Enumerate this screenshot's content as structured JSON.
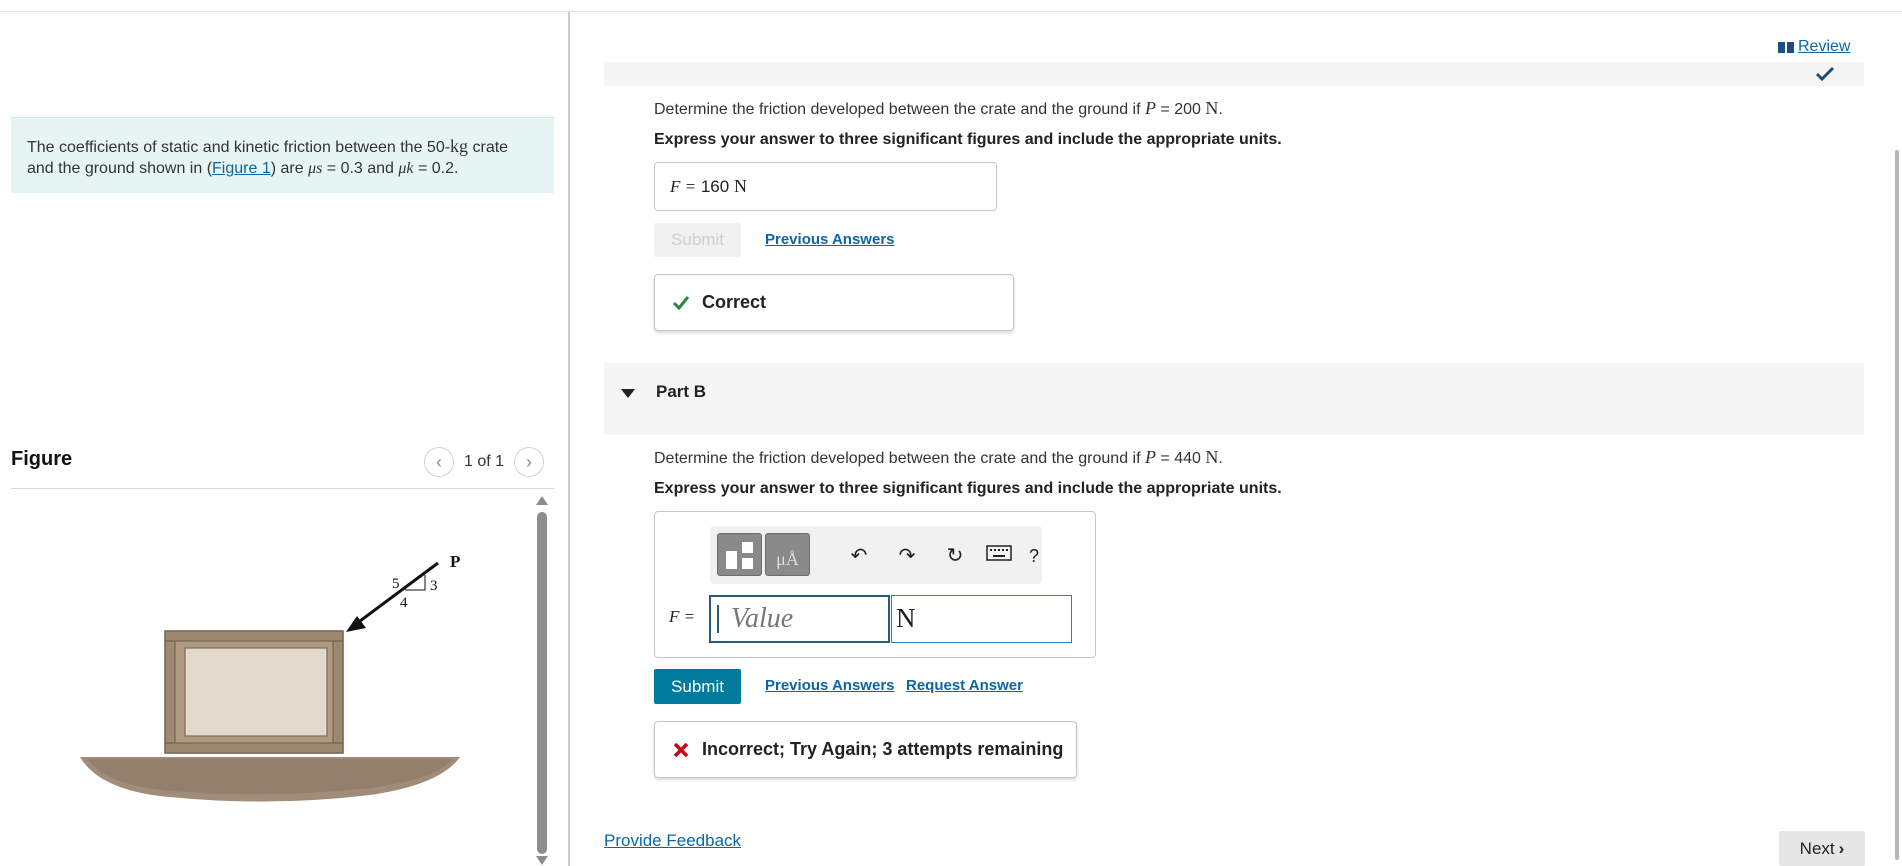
{
  "problem": {
    "text_before": "The coefficients of static and kinetic friction between the 50-",
    "mass_unit": "kg",
    "text_mid": " crate and the ground shown in (",
    "figure_link": "Figure 1",
    "text_after": ") are ",
    "mu_s": "μs",
    "mu_s_value": " = 0.3 and ",
    "mu_k": "μk",
    "mu_k_value": " = 0.2."
  },
  "figure_panel": {
    "title": "Figure",
    "counter": "1 of 1",
    "prev_icon": "chevron-left-icon",
    "next_icon": "chevron-right-icon",
    "diagram": {
      "force_label": "P",
      "slope_hyp": "5",
      "slope_rise": "3",
      "slope_run": "4"
    }
  },
  "header": {
    "review_label": "Review",
    "review_icon": "book-icon"
  },
  "part_a": {
    "question_prefix": "Determine the friction developed between the crate and the ground if ",
    "P_symbol": "P",
    "question_value": " = 200 ",
    "question_unit": "N",
    "question_suffix": ".",
    "instruction": "Express your answer to three significant figures and include the appropriate units.",
    "answer_label": "F =",
    "answer_value": "160",
    "answer_unit": "N",
    "submit_label": "Submit",
    "previous_answers_label": "Previous Answers",
    "result_label": "Correct",
    "result_icon": "checkmark-icon",
    "result_color": "#2e8540"
  },
  "part_b": {
    "header": "Part B",
    "question_prefix": "Determine the friction developed between the crate and the ground if ",
    "P_symbol": "P",
    "question_value": " = 440 ",
    "question_unit": "N",
    "question_suffix": ".",
    "instruction": "Express your answer to three significant figures and include the appropriate units.",
    "toolbar": {
      "templates_icon": "templates-icon",
      "units_button": "μÅ",
      "undo_icon": "undo-icon",
      "redo_icon": "redo-icon",
      "reset_icon": "reset-icon",
      "keyboard_icon": "keyboard-icon",
      "help_label": "?"
    },
    "answer_label": "F =",
    "value_placeholder": "Value",
    "unit_value": "N",
    "submit_label": "Submit",
    "previous_answers_label": "Previous Answers",
    "request_answer_label": "Request Answer",
    "result_label": "Incorrect; Try Again; 3 attempts remaining",
    "result_icon": "x-icon",
    "result_color": "#d0021b"
  },
  "footer": {
    "provide_feedback_label": "Provide Feedback",
    "next_label": "Next"
  },
  "colors": {
    "accent": "#007b9c",
    "link": "#0d66a4",
    "problem_bg": "#e6f5f4"
  }
}
